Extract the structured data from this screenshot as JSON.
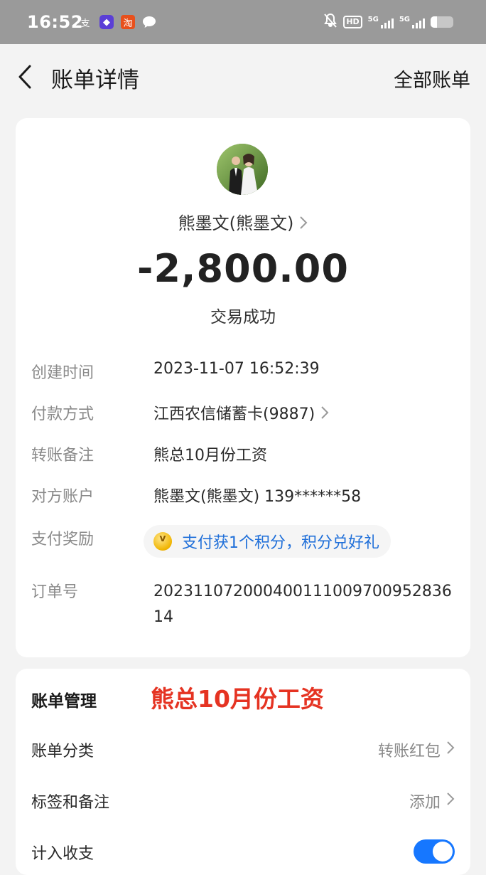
{
  "status_bar": {
    "time": "16:52",
    "apps": [
      {
        "icon": "alipay-icon",
        "glyph": "支"
      },
      {
        "icon": "app-diamond-icon",
        "glyph": "◆"
      },
      {
        "icon": "taobao-icon",
        "glyph": "淘"
      },
      {
        "icon": "message-bubble-icon",
        "glyph": ""
      }
    ],
    "hd_label": "HD",
    "network_label_1": "5G",
    "network_label_2": "5G"
  },
  "nav": {
    "title": "账单详情",
    "right_link": "全部账单"
  },
  "transaction": {
    "payee": "熊墨文(熊墨文)",
    "amount": "-2,800.00",
    "status": "交易成功"
  },
  "details": {
    "created_time": {
      "label": "创建时间",
      "value": "2023-11-07 16:52:39"
    },
    "payment_method": {
      "label": "付款方式",
      "value": "江西农信储蓄卡(9887)"
    },
    "transfer_note": {
      "label": "转账备注",
      "value": "熊总10月份工资"
    },
    "counterparty": {
      "label": "对方账户",
      "value": "熊墨文(熊墨文) 139******58"
    },
    "reward": {
      "label": "支付奖励",
      "value": "支付获1个积分，积分兑好礼"
    },
    "order_no": {
      "label": "订单号",
      "value": "20231107200040011100970095283614"
    }
  },
  "manage": {
    "title": "账单管理",
    "overlay_note": "熊总10月份工资",
    "category": {
      "label": "账单分类",
      "value": "转账红包"
    },
    "tags": {
      "label": "标签和备注",
      "value": "添加"
    },
    "include": {
      "label": "计入收支",
      "enabled": true
    }
  },
  "colors": {
    "accent_blue": "#1677ff",
    "link_blue": "#1f6fd9",
    "overlay_red": "#e53322"
  }
}
